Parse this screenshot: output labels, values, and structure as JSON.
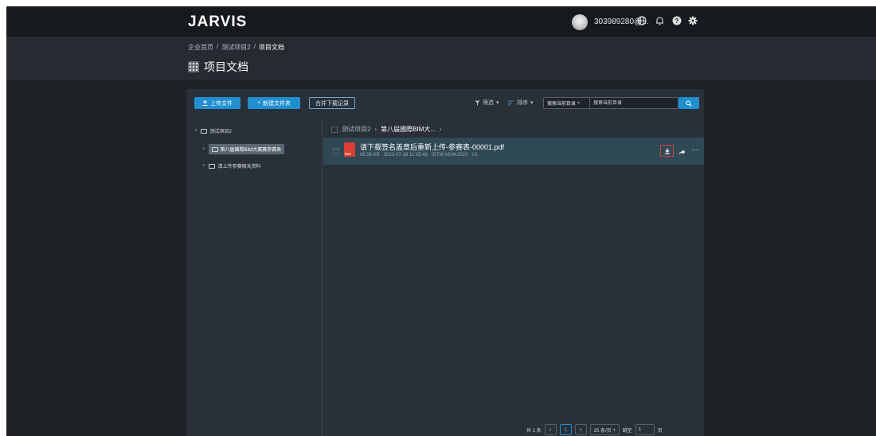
{
  "app": {
    "logo": "JARVIS",
    "username": "303989280@..."
  },
  "icons": {
    "globe": "globe-icon",
    "bell": "bell-icon",
    "help": "help-icon",
    "settings": "gear-icon"
  },
  "breadcrumb": {
    "home": "企业首页",
    "sep": "/",
    "project": "测试项目2",
    "current": "项目文档"
  },
  "page": {
    "title": "项目文档"
  },
  "toolbar": {
    "upload_label": "上传文件",
    "new_folder_label": "新建文件夹",
    "merge_download_label": "合并下载记录",
    "filter_label": "筛选",
    "sort_label": "排序",
    "search_scope": "搜索当前目录",
    "search_placeholder": "搜索当前目录"
  },
  "tree": {
    "root": "测试项目2",
    "items": [
      {
        "label": "第八届國際BIM大赛赛参赛表",
        "selected": true
      },
      {
        "label": "请上传参赛相关资料",
        "selected": false
      }
    ]
  },
  "filebrowser": {
    "path_root": "测试项目2",
    "path_current": "第八届國際BIM大...",
    "files": [
      {
        "name": "请下载签名盖章后重新上传-参赛表-00001.pdf",
        "size": "96.56 KB",
        "date": "2023-07-28 11:05:48",
        "uploader": "IDTM bSHK2023",
        "version": "V1"
      }
    ]
  },
  "pagination": {
    "total": "共 1 条",
    "current_page": "1",
    "page_size": "25 条/页",
    "goto_label": "跳至",
    "goto_value": "1",
    "page_unit": "页"
  },
  "colors": {
    "accent": "#1e8fd1",
    "highlight_row": "#2f4a55",
    "download_border": "#e0342c"
  }
}
